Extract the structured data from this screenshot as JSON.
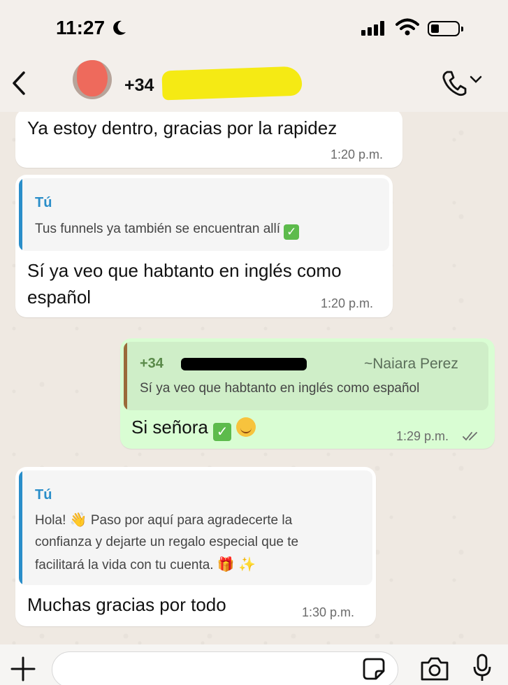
{
  "status_bar": {
    "time": "11:27"
  },
  "header": {
    "contact_prefix": "+34"
  },
  "messages": [
    {
      "direction": "in",
      "text": "Ya estoy dentro, gracias por la rapidez",
      "time": "1:20 p.m."
    },
    {
      "direction": "in",
      "quote_author": "Tú",
      "quote_text": "Tus funnels ya también se encuentran allí",
      "text_line1": "Sí ya veo que habtanto en inglés como",
      "text_line2": "español",
      "time": "1:20 p.m."
    },
    {
      "direction": "out",
      "quote_author": "+34",
      "quote_alias": "~Naiara Perez",
      "quote_text": "Sí ya veo que habtanto en inglés como español",
      "text": "Si señora",
      "time": "1:29 p.m."
    },
    {
      "direction": "in",
      "quote_author": "Tú",
      "quote_line1_a": "Hola!",
      "quote_line1_b": "Paso por aquí para agradecerte la",
      "quote_line2": "confianza y dejarte un regalo especial que te",
      "quote_line3": "facilitará la vida con tu cuenta.",
      "text": "Muchas gracias por todo",
      "time": "1:30 p.m."
    }
  ],
  "icons": {
    "back": "chevron-left-icon",
    "call": "phone-icon",
    "plus": "plus-icon",
    "sticker": "sticker-icon",
    "camera": "camera-icon",
    "mic": "microphone-icon"
  },
  "colors": {
    "outgoing_bubble": "#d9fdd3",
    "incoming_bubble": "#ffffff",
    "quote_author": "#2a8ec9",
    "wallpaper": "#efe9e2"
  }
}
